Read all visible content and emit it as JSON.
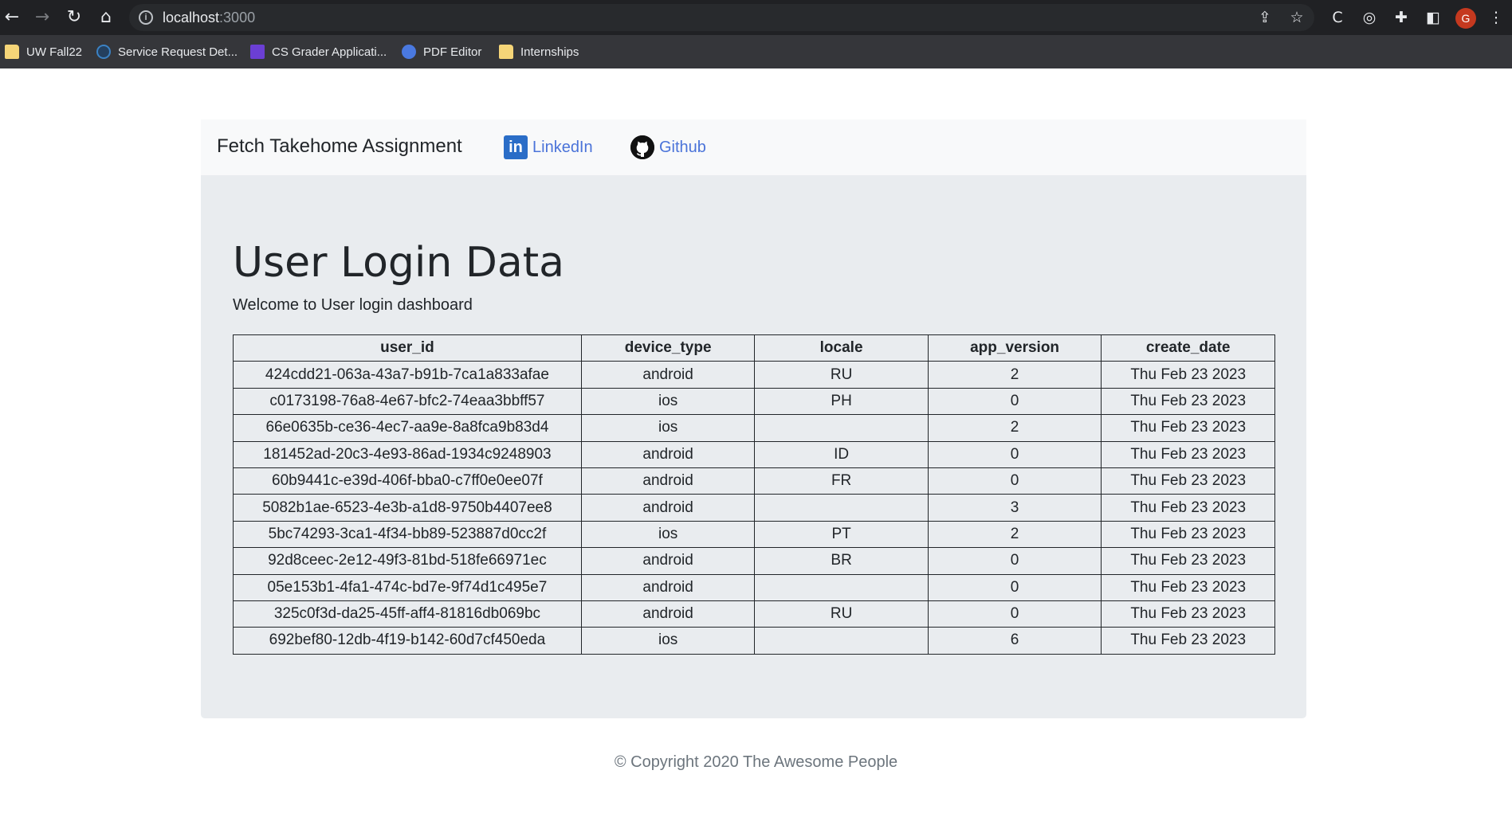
{
  "browser": {
    "url_host": "localhost",
    "url_port": ":3000",
    "avatar_initial": "G",
    "bookmarks": [
      {
        "label": "UW Fall22",
        "icon": "folder-icon"
      },
      {
        "label": "Service Request Det...",
        "icon": "dell-icon"
      },
      {
        "label": "CS Grader Applicati...",
        "icon": "forms-icon"
      },
      {
        "label": "PDF Editor",
        "icon": "pdf-editor-icon"
      },
      {
        "label": "Internships",
        "icon": "folder-icon"
      }
    ]
  },
  "navbar": {
    "brand": "Fetch Takehome Assignment",
    "linkedin_label": "LinkedIn",
    "linkedin_logo": "in",
    "github_label": "Github"
  },
  "main": {
    "title": "User Login Data",
    "subtitle": "Welcome to User login dashboard"
  },
  "table": {
    "headers": [
      "user_id",
      "device_type",
      "locale",
      "app_version",
      "create_date"
    ],
    "rows": [
      [
        "424cdd21-063a-43a7-b91b-7ca1a833afae",
        "android",
        "RU",
        "2",
        "Thu Feb 23 2023"
      ],
      [
        "c0173198-76a8-4e67-bfc2-74eaa3bbff57",
        "ios",
        "PH",
        "0",
        "Thu Feb 23 2023"
      ],
      [
        "66e0635b-ce36-4ec7-aa9e-8a8fca9b83d4",
        "ios",
        "",
        "2",
        "Thu Feb 23 2023"
      ],
      [
        "181452ad-20c3-4e93-86ad-1934c9248903",
        "android",
        "ID",
        "0",
        "Thu Feb 23 2023"
      ],
      [
        "60b9441c-e39d-406f-bba0-c7ff0e0ee07f",
        "android",
        "FR",
        "0",
        "Thu Feb 23 2023"
      ],
      [
        "5082b1ae-6523-4e3b-a1d8-9750b4407ee8",
        "android",
        "",
        "3",
        "Thu Feb 23 2023"
      ],
      [
        "5bc74293-3ca1-4f34-bb89-523887d0cc2f",
        "ios",
        "PT",
        "2",
        "Thu Feb 23 2023"
      ],
      [
        "92d8ceec-2e12-49f3-81bd-518fe66971ec",
        "android",
        "BR",
        "0",
        "Thu Feb 23 2023"
      ],
      [
        "05e153b1-4fa1-474c-bd7e-9f74d1c495e7",
        "android",
        "",
        "0",
        "Thu Feb 23 2023"
      ],
      [
        "325c0f3d-da25-45ff-aff4-81816db069bc",
        "android",
        "RU",
        "0",
        "Thu Feb 23 2023"
      ],
      [
        "692bef80-12db-4f19-b142-60d7cf450eda",
        "ios",
        "",
        "6",
        "Thu Feb 23 2023"
      ]
    ]
  },
  "footer": {
    "copyright": "© Copyright 2020 The Awesome People"
  }
}
